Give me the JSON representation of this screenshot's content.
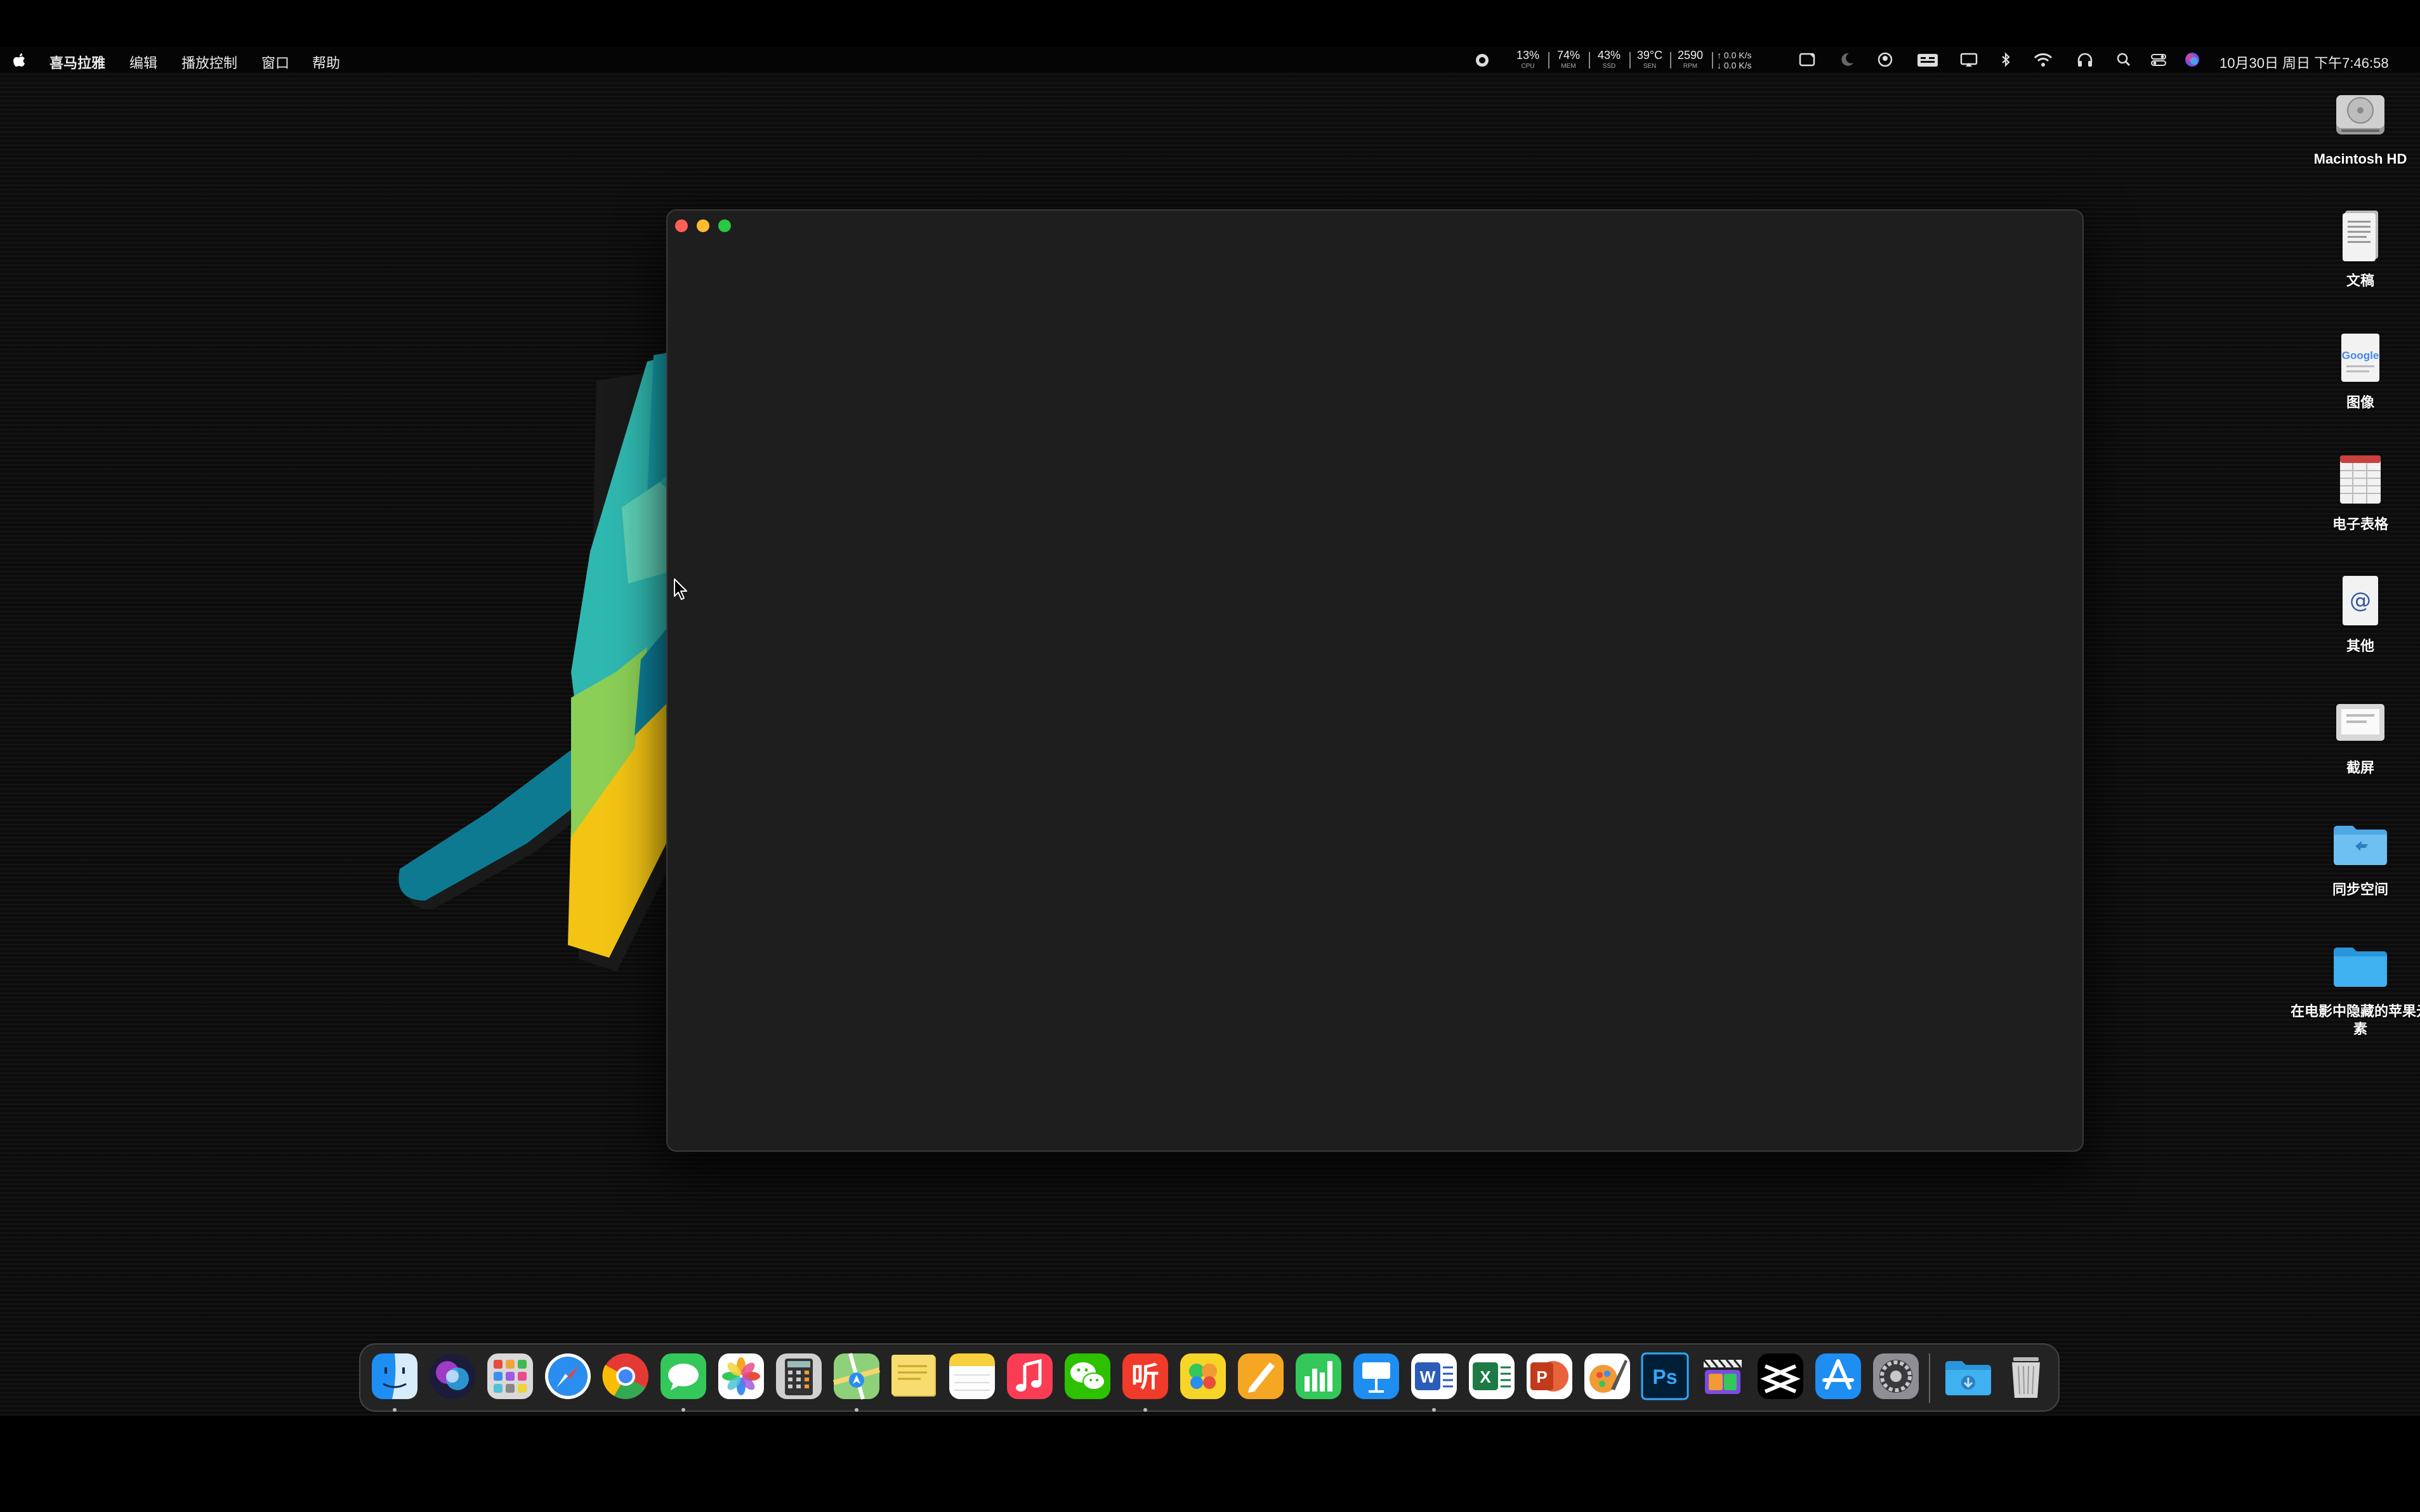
{
  "menubar": {
    "app_name": "喜马拉雅",
    "menus": [
      "编辑",
      "播放控制",
      "窗口",
      "帮助"
    ],
    "stats": [
      {
        "value": "13%",
        "label": "CPU"
      },
      {
        "value": "74%",
        "label": "MEM"
      },
      {
        "value": "43%",
        "label": "SSD"
      },
      {
        "value": "39°C",
        "label": "SEN"
      },
      {
        "value": "2590",
        "label": "RPM"
      }
    ],
    "net_up": "↑ 0.0 K/s",
    "net_down": "↓ 0.0 K/s",
    "clock": "10月30日 周日 下午7:46:58"
  },
  "desktop_icons": [
    {
      "label": "Macintosh HD",
      "icon": "hard-drive-icon"
    },
    {
      "label": "文稿",
      "icon": "document-icon"
    },
    {
      "label": "图像",
      "icon": "image-icon"
    },
    {
      "label": "电子表格",
      "icon": "spreadsheet-icon"
    },
    {
      "label": "其他",
      "icon": "other-file-icon"
    },
    {
      "label": "截屏",
      "icon": "screenshot-icon"
    },
    {
      "label": "同步空间",
      "icon": "sync-folder-icon"
    },
    {
      "label": "在电影中隐藏的苹果元素",
      "icon": "folder-icon"
    }
  ],
  "dock": {
    "apps": [
      "finder",
      "siri",
      "launchpad",
      "safari",
      "chrome",
      "messages",
      "photos",
      "calculator",
      "maps",
      "stickies",
      "notes",
      "music",
      "wechat",
      "ximalaya",
      "photo-app",
      "pages",
      "numbers",
      "keynote",
      "word",
      "excel",
      "powerpoint",
      "pixelmator",
      "photoshop",
      "final-cut-pro",
      "capcut",
      "app-store",
      "system-preferences"
    ],
    "running": [
      "finder",
      "messages",
      "maps",
      "ximalaya",
      "word"
    ],
    "extras": [
      "downloads-folder",
      "trash"
    ],
    "ximalaya_glyph": "听",
    "photoshop_glyph": "Ps",
    "word_glyph": "W",
    "excel_glyph": "X",
    "powerpoint_glyph": "P",
    "capcut_glyph": "≋",
    "google_glyph": "Google"
  },
  "colors": {
    "close": "#ff5f57",
    "minimize": "#febc2e",
    "maximize": "#28c840",
    "window_bg": "#1e1e1e"
  }
}
